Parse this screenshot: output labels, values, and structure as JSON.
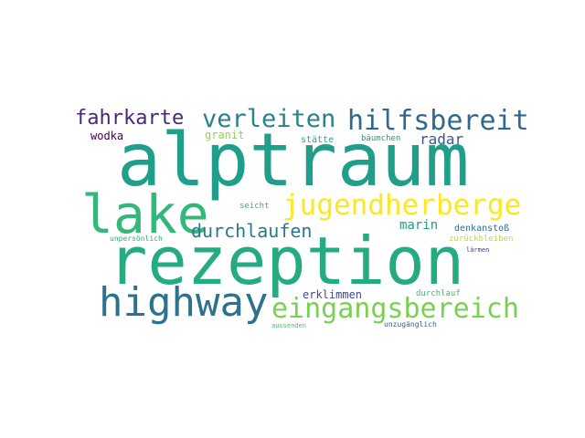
{
  "word_cloud": {
    "words": [
      {
        "text": "alptraum",
        "color": "#1f9e89"
      },
      {
        "text": "rezeption",
        "color": "#25ab82"
      },
      {
        "text": "lake",
        "color": "#35b779"
      },
      {
        "text": "highway",
        "color": "#2c728e"
      },
      {
        "text": "jugendherberge",
        "color": "#fde725"
      },
      {
        "text": "eingangsbereich",
        "color": "#7ad151"
      },
      {
        "text": "hilfsbereit",
        "color": "#31688e"
      },
      {
        "text": "verleiten",
        "color": "#26828e"
      },
      {
        "text": "fahrkarte",
        "color": "#482878"
      },
      {
        "text": "durchlaufen",
        "color": "#2a788e"
      },
      {
        "text": "radar",
        "color": "#38588c"
      },
      {
        "text": "marin",
        "color": "#1f9e89"
      },
      {
        "text": "erklimmen",
        "color": "#3e4a89"
      },
      {
        "text": "wodka",
        "color": "#440154"
      },
      {
        "text": "granit",
        "color": "#90d743"
      },
      {
        "text": "stätte",
        "color": "#22a884"
      },
      {
        "text": "bäumchen",
        "color": "#1fa187"
      },
      {
        "text": "seicht",
        "color": "#2db27d"
      },
      {
        "text": "denkanstoß",
        "color": "#2e6e8e"
      },
      {
        "text": "zurückbleiben",
        "color": "#c2df23"
      },
      {
        "text": "unpersönlich",
        "color": "#26ad81"
      },
      {
        "text": "lärmen",
        "color": "#443983"
      },
      {
        "text": "durchlauf",
        "color": "#3bbb75"
      },
      {
        "text": "aussenden",
        "color": "#4ac16d"
      },
      {
        "text": "unzugänglich",
        "color": "#355f8d"
      }
    ]
  }
}
